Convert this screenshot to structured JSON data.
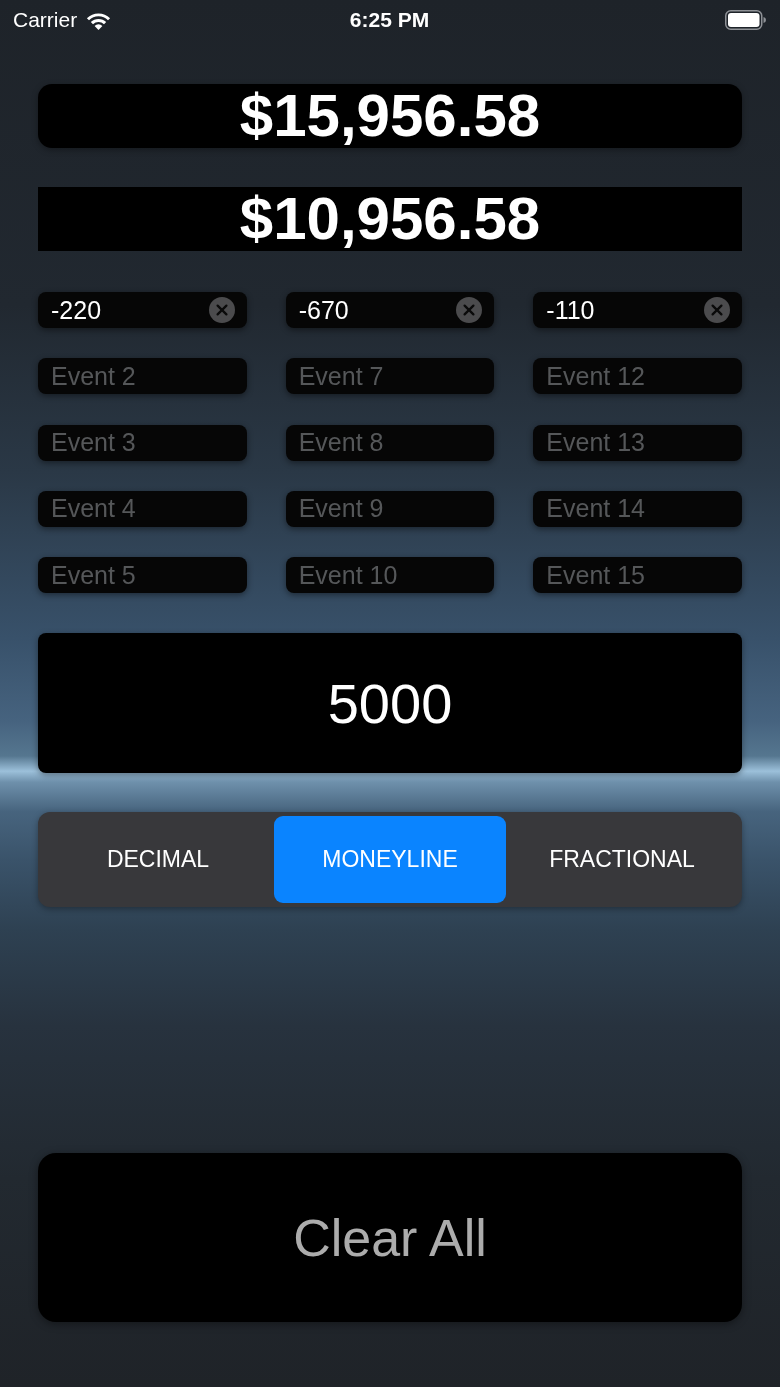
{
  "status_bar": {
    "carrier": "Carrier",
    "time": "6:25 PM"
  },
  "amounts": [
    {
      "kind": "rounded",
      "value": "$15,956.58"
    },
    {
      "kind": "square",
      "value": "$10,956.58"
    }
  ],
  "event_columns": [
    {
      "fields": [
        {
          "value": "-220"
        },
        {
          "placeholder": "Event 2"
        },
        {
          "placeholder": "Event 3"
        },
        {
          "placeholder": "Event 4"
        },
        {
          "placeholder": "Event 5"
        }
      ]
    },
    {
      "fields": [
        {
          "value": "-670"
        },
        {
          "placeholder": "Event 7"
        },
        {
          "placeholder": "Event 8"
        },
        {
          "placeholder": "Event 9"
        },
        {
          "placeholder": "Event 10"
        }
      ]
    },
    {
      "fields": [
        {
          "value": "-110"
        },
        {
          "placeholder": "Event 12"
        },
        {
          "placeholder": "Event 13"
        },
        {
          "placeholder": "Event 14"
        },
        {
          "placeholder": "Event 15"
        }
      ]
    }
  ],
  "stake_field": {
    "value": "5000"
  },
  "odds_format": [
    {
      "label": "DECIMAL",
      "selected": false
    },
    {
      "label": "MONEYLINE",
      "selected": true
    },
    {
      "label": "FRACTIONAL",
      "selected": false
    }
  ],
  "clear_all_button": {
    "label": "Clear All"
  }
}
